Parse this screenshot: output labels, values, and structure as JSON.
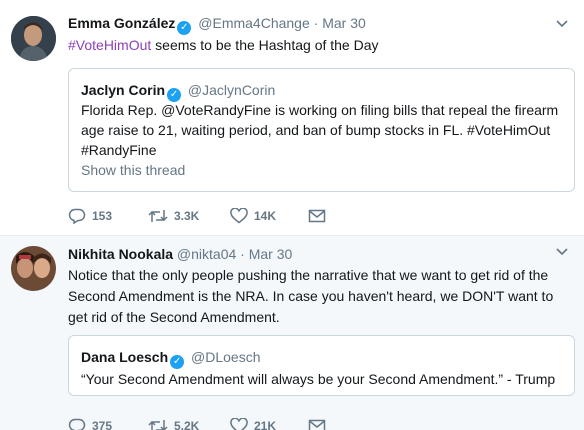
{
  "tweets": [
    {
      "name": "Emma González",
      "handle": "@Emma4Change",
      "separator": "·",
      "date": "Mar 30",
      "hashtag": "#VoteHimOut",
      "text_rest": " seems to be the Hashtag of the Day",
      "quote": {
        "name": "Jaclyn Corin",
        "handle": "@JaclynCorin",
        "text": "Florida Rep. @VoteRandyFine is working on filing bills that repeal the firearm age raise to 21, waiting period, and ban of bump stocks in FL. #VoteHimOut #RandyFine",
        "show_thread": "Show this thread"
      },
      "replies": "153",
      "retweets": "3.3K",
      "likes": "14K"
    },
    {
      "name": "Nikhita Nookala",
      "handle": "@nikta04",
      "separator": "·",
      "date": "Mar 30",
      "text": "Notice that the only people pushing the narrative that we want to get rid of the Second Amendment is the NRA. In case you haven't heard, we DON'T want to get rid of the Second Amendment.",
      "quote": {
        "name": "Dana Loesch",
        "handle": "@DLoesch",
        "text": "“Your Second Amendment will always be your Second Amendment.” - Trump"
      },
      "replies": "375",
      "retweets": "5.2K",
      "likes": "21K"
    }
  ],
  "icons": {
    "verified": "verified-badge-icon",
    "caret": "chevron-down-icon",
    "reply": "reply-icon",
    "retweet": "retweet-icon",
    "like": "heart-icon",
    "message": "envelope-icon"
  },
  "colors": {
    "verified": "#1da1f2",
    "hashtag": "#8e3fb8",
    "muted": "#657786",
    "second_tweet_bg": "#f5f8fa"
  }
}
